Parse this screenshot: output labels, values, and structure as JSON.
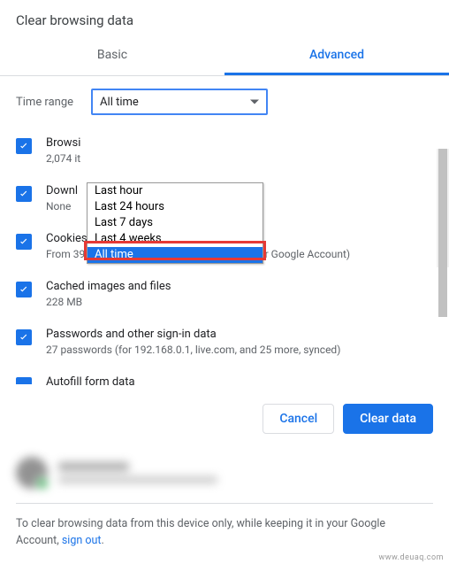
{
  "title": "Clear browsing data",
  "tabs": {
    "basic": "Basic",
    "advanced": "Advanced"
  },
  "time_range": {
    "label": "Time range",
    "selected": "All time",
    "options": [
      "Last hour",
      "Last 24 hours",
      "Last 7 days",
      "Last 4 weeks",
      "All time"
    ]
  },
  "items": [
    {
      "title": "Browsi",
      "sub": "2,074 it"
    },
    {
      "title": "Downl",
      "sub": "None"
    },
    {
      "title": "Cookies and other site data",
      "sub": "From 397 sites (you won't be signed out of your Google Account)"
    },
    {
      "title": "Cached images and files",
      "sub": "228 MB"
    },
    {
      "title": "Passwords and other sign-in data",
      "sub": "27 passwords (for 192.168.0.1, live.com, and 25 more, synced)"
    },
    {
      "title": "Autofill form data",
      "sub": ""
    }
  ],
  "actions": {
    "cancel": "Cancel",
    "clear": "Clear data"
  },
  "footer": {
    "text_before": "To clear browsing data from this device only, while keeping it in your Google Account, ",
    "link": "sign out",
    "text_after": "."
  },
  "watermark": "www.deuaq.com"
}
